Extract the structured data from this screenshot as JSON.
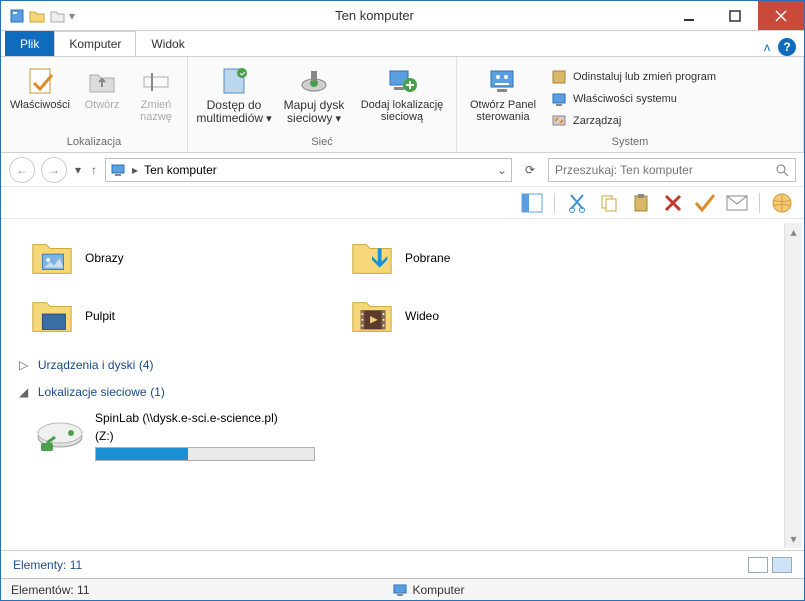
{
  "window": {
    "title": "Ten komputer"
  },
  "tabs": {
    "file": "Plik",
    "computer": "Komputer",
    "view": "Widok"
  },
  "ribbon": {
    "group1_label": "Lokalizacja",
    "properties": "Właściwości",
    "open": "Otwórz",
    "rename": "Zmień nazwę",
    "group2_label": "Sieć",
    "media_access": "Dostęp do multimediów",
    "map_drive": "Mapuj dysk sieciowy",
    "add_netloc": "Dodaj lokalizację sieciową",
    "group3_label": "System",
    "control_panel": "Otwórz Panel sterowania",
    "uninstall": "Odinstaluj lub zmień program",
    "sys_props": "Właściwości systemu",
    "manage": "Zarządzaj"
  },
  "address": {
    "location": "Ten komputer"
  },
  "search": {
    "placeholder": "Przeszukaj: Ten komputer"
  },
  "folders": {
    "obrazy": "Obrazy",
    "pobrane": "Pobrane",
    "pulpit": "Pulpit",
    "wideo": "Wideo"
  },
  "sections": {
    "devices": "Urządzenia i dyski",
    "devices_count": "(4)",
    "netloc": "Lokalizacje sieciowe",
    "netloc_count": "(1)"
  },
  "netdrive": {
    "name": "SpinLab (\\\\dysk.e-sci.e-science.pl)",
    "letter": "(Z:)",
    "fill_percent": 42
  },
  "footer": {
    "elements1": "Elementy: 11",
    "elements2": "Elementów: 11",
    "computer": "Komputer"
  }
}
